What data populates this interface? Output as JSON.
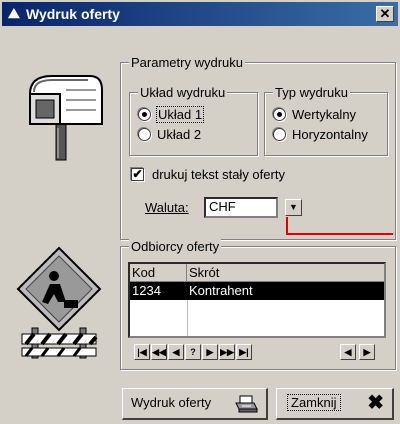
{
  "window": {
    "title": "Wydruk oferty",
    "title_icon": "⛰",
    "close_glyph": "✕"
  },
  "params": {
    "legend": "Parametry wydruku",
    "layout": {
      "legend": "Układ wydruku",
      "options": [
        "Układ 1",
        "Układ 2"
      ],
      "selected": 0
    },
    "type": {
      "legend": "Typ wydruku",
      "options": [
        "Wertykalny",
        "Horyzontalny"
      ],
      "selected": 0
    },
    "fixed_text": {
      "label": "drukuj tekst stały oferty",
      "checked": true
    },
    "currency": {
      "label": "Waluta:",
      "value": "CHF"
    }
  },
  "recipients": {
    "legend": "Odbiorcy oferty",
    "columns": [
      "Kod",
      "Skrót"
    ],
    "rows": [
      {
        "kod": "1234",
        "skrot": "Kontrahent"
      }
    ],
    "nav": [
      "|◀",
      "◀◀",
      "◀",
      "?",
      "▶",
      "▶▶",
      "▶|"
    ],
    "scroll": [
      "◀",
      "▶"
    ]
  },
  "buttons": {
    "print": {
      "label": "Wydruk oferty",
      "icon": "printer-icon"
    },
    "close": {
      "label": "Zamknij",
      "icon": "close-x-icon"
    }
  },
  "colors": {
    "title_gradient_start": "#0a246a",
    "title_gradient_end": "#3a6ea5",
    "dialog_bg": "#d4d0c8",
    "annotation_line": "#e00000"
  }
}
